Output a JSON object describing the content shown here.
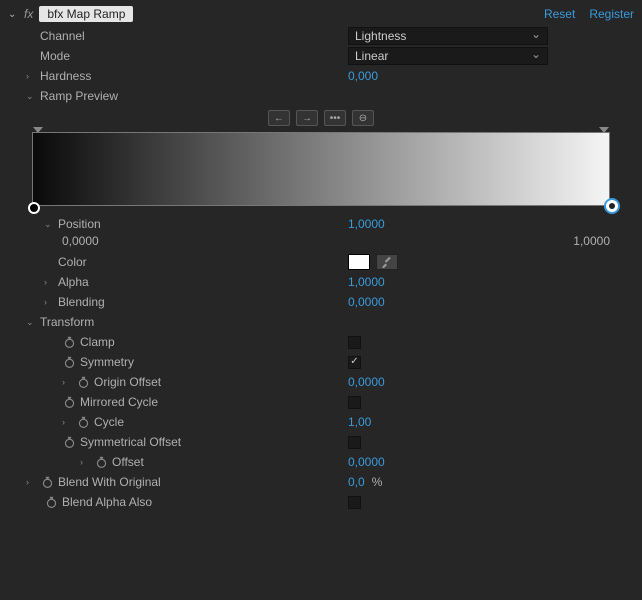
{
  "header": {
    "effect_name": "bfx Map Ramp",
    "reset": "Reset",
    "register": "Register"
  },
  "channel": {
    "label": "Channel",
    "value": "Lightness"
  },
  "mode": {
    "label": "Mode",
    "value": "Linear"
  },
  "hardness": {
    "label": "Hardness",
    "value": "0,000"
  },
  "ramp_preview": {
    "label": "Ramp Preview"
  },
  "position": {
    "label": "Position",
    "value": "1,0000",
    "min": "0,0000",
    "max": "1,0000"
  },
  "color": {
    "label": "Color"
  },
  "alpha": {
    "label": "Alpha",
    "value": "1,0000"
  },
  "blending": {
    "label": "Blending",
    "value": "0,0000"
  },
  "transform": {
    "label": "Transform",
    "clamp": {
      "label": "Clamp",
      "checked": false
    },
    "symmetry": {
      "label": "Symmetry",
      "checked": true
    },
    "origin_offset": {
      "label": "Origin Offset",
      "value": "0,0000"
    },
    "mirrored_cycle": {
      "label": "Mirrored Cycle",
      "checked": false
    },
    "cycle": {
      "label": "Cycle",
      "value": "1,00"
    },
    "symmetrical_offset": {
      "label": "Symmetrical Offset",
      "checked": false
    },
    "offset": {
      "label": "Offset",
      "value": "0,0000"
    }
  },
  "blend_original": {
    "label": "Blend With Original",
    "value": "0,0",
    "suffix": "%"
  },
  "blend_alpha": {
    "label": "Blend Alpha Also",
    "checked": false
  }
}
